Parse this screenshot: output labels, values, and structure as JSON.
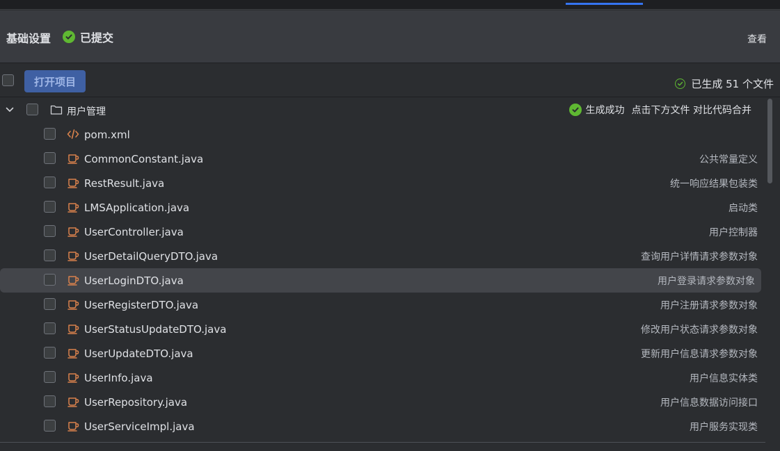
{
  "header": {
    "title": "基础设置",
    "status_label": "已提交",
    "view_label": "查看"
  },
  "toolbar": {
    "open_project_label": "打开项目",
    "generated_count_text": "已生成 51 个文件"
  },
  "tree": {
    "folder": {
      "label": "用户管理",
      "status_ok": "生成成功",
      "status_hint": "点击下方文件 对比代码合并"
    },
    "files": [
      {
        "name": "pom.xml",
        "desc": "",
        "icon": "xml-code-icon"
      },
      {
        "name": "CommonConstant.java",
        "desc": "公共常量定义",
        "icon": "java-cup-icon"
      },
      {
        "name": "RestResult.java",
        "desc": "统一响应结果包装类",
        "icon": "java-cup-icon"
      },
      {
        "name": "LMSApplication.java",
        "desc": "启动类",
        "icon": "java-cup-icon"
      },
      {
        "name": "UserController.java",
        "desc": "用户控制器",
        "icon": "java-cup-icon"
      },
      {
        "name": "UserDetailQueryDTO.java",
        "desc": "查询用户详情请求参数对象",
        "icon": "java-cup-icon"
      },
      {
        "name": "UserLoginDTO.java",
        "desc": "用户登录请求参数对象",
        "icon": "java-cup-icon",
        "selected": true
      },
      {
        "name": "UserRegisterDTO.java",
        "desc": "用户注册请求参数对象",
        "icon": "java-cup-icon"
      },
      {
        "name": "UserStatusUpdateDTO.java",
        "desc": "修改用户状态请求参数对象",
        "icon": "java-cup-icon"
      },
      {
        "name": "UserUpdateDTO.java",
        "desc": "更新用户信息请求参数对象",
        "icon": "java-cup-icon"
      },
      {
        "name": "UserInfo.java",
        "desc": "用户信息实体类",
        "icon": "java-cup-icon"
      },
      {
        "name": "UserRepository.java",
        "desc": "用户信息数据访问接口",
        "icon": "java-cup-icon"
      },
      {
        "name": "UserServiceImpl.java",
        "desc": "用户服务实现类",
        "icon": "java-cup-icon"
      }
    ]
  },
  "colors": {
    "accent": "#3574f0",
    "success": "#5fb832",
    "java_icon": "#d9824c"
  }
}
